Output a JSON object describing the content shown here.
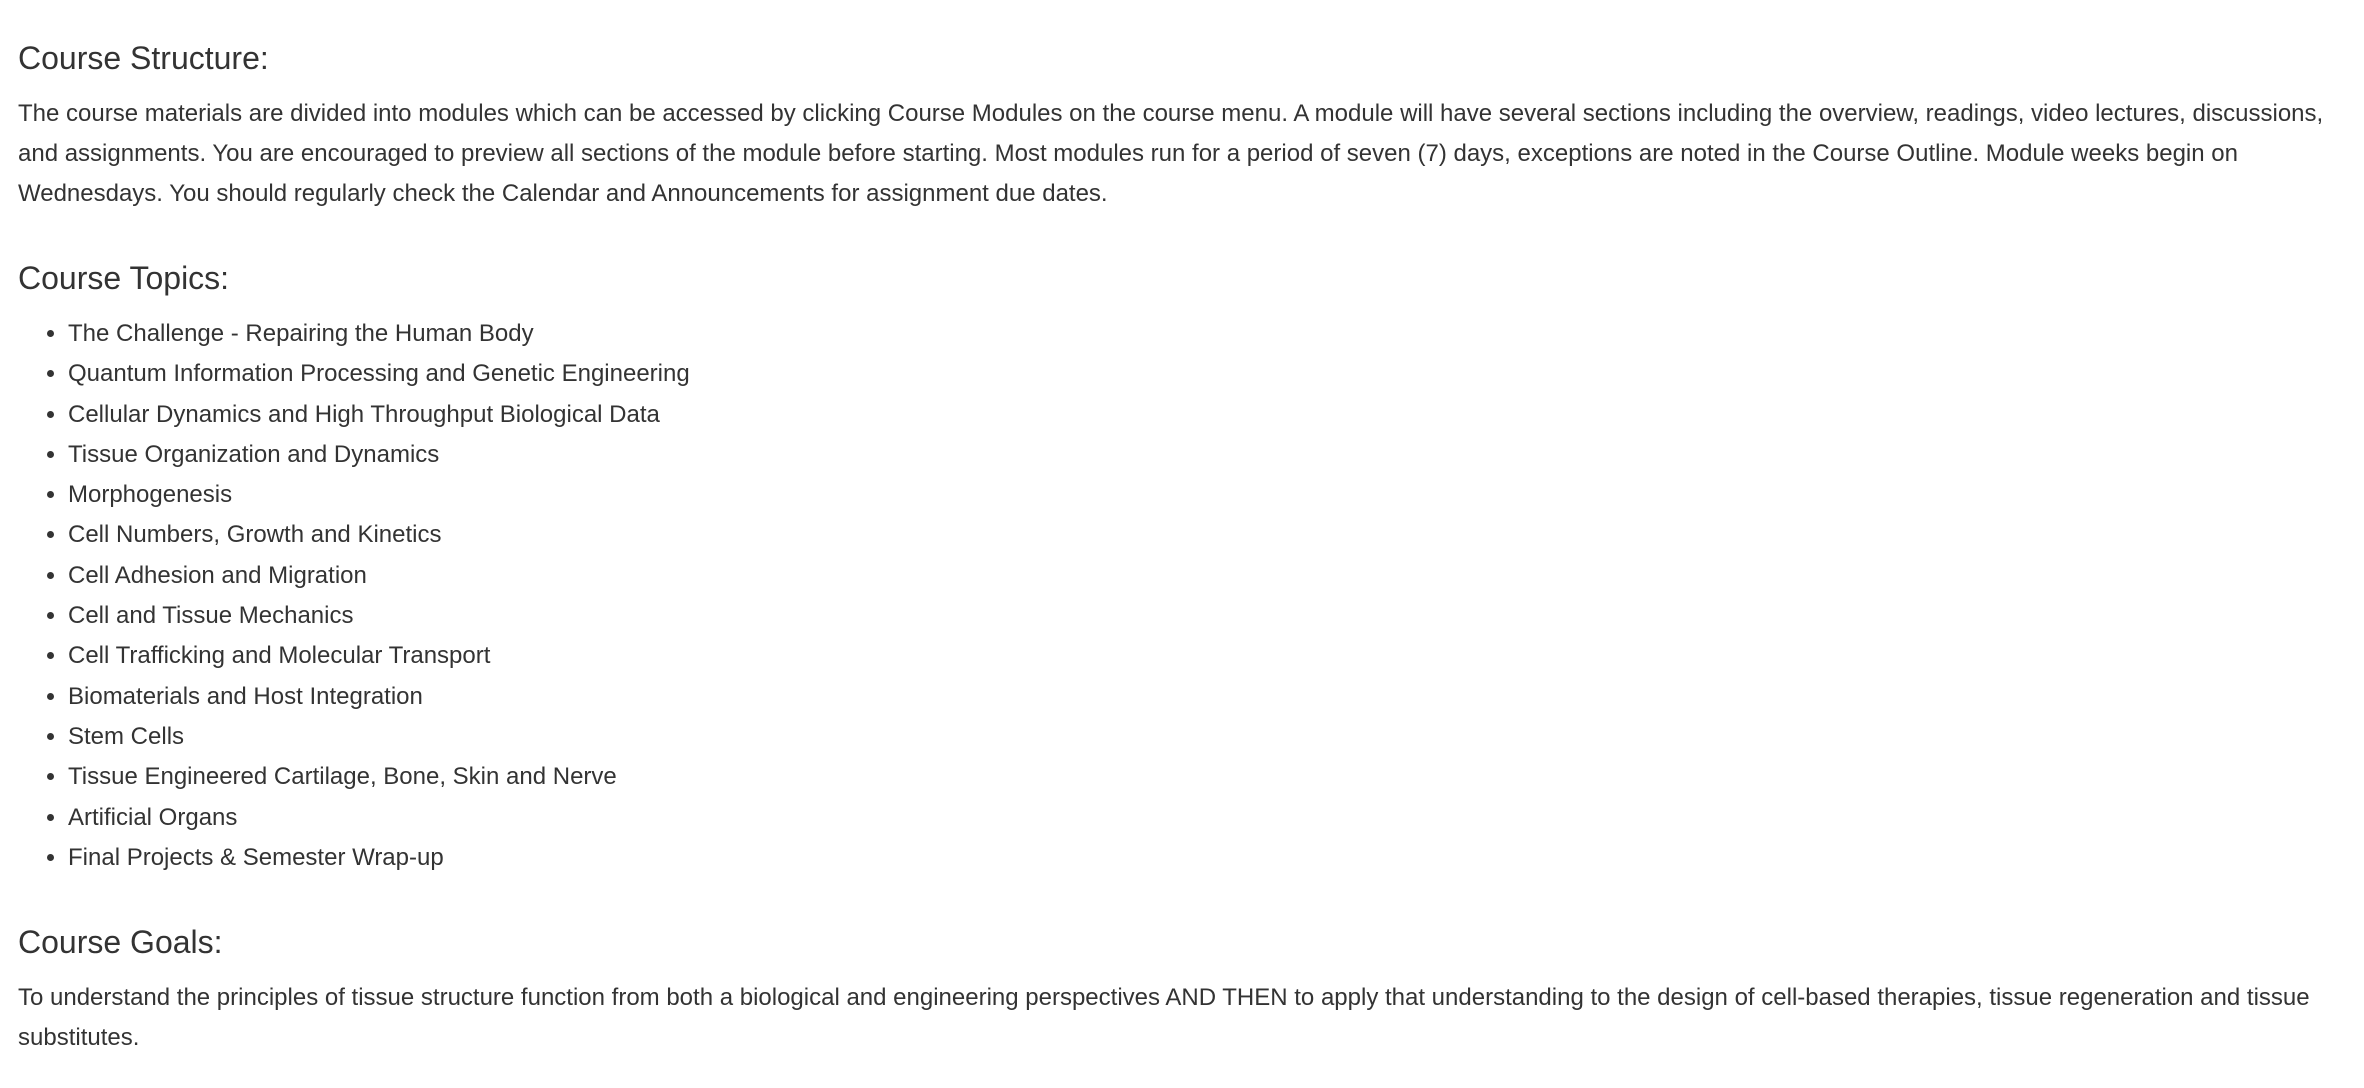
{
  "structure": {
    "heading": "Course Structure:",
    "body": "The course materials are divided into modules which can be accessed by clicking Course Modules on the course menu. A module will have several sections including the overview, readings, video lectures, discussions, and assignments. You are encouraged to preview all sections of the module before starting. Most modules run for a period of seven (7) days, exceptions are noted in the Course Outline. Module weeks begin on Wednesdays. You should regularly check the Calendar and Announcements for assignment due dates."
  },
  "topics": {
    "heading": "Course Topics:",
    "items": [
      "The Challenge - Repairing the Human Body",
      "Quantum Information Processing and Genetic Engineering",
      "Cellular Dynamics and High Throughput Biological Data",
      "Tissue Organization and Dynamics",
      "Morphogenesis",
      "Cell Numbers, Growth and Kinetics",
      "Cell Adhesion and Migration",
      "Cell and Tissue Mechanics",
      "Cell Trafficking and Molecular Transport",
      "Biomaterials and Host Integration",
      "Stem Cells",
      "Tissue Engineered Cartilage, Bone, Skin and Nerve",
      "Artificial Organs",
      "Final Projects & Semester Wrap-up"
    ]
  },
  "goals": {
    "heading": "Course Goals:",
    "body": "To understand the principles of tissue structure function from both a biological and engineering perspectives AND THEN to apply that understanding to the design of cell-based therapies, tissue regeneration and tissue substitutes."
  }
}
